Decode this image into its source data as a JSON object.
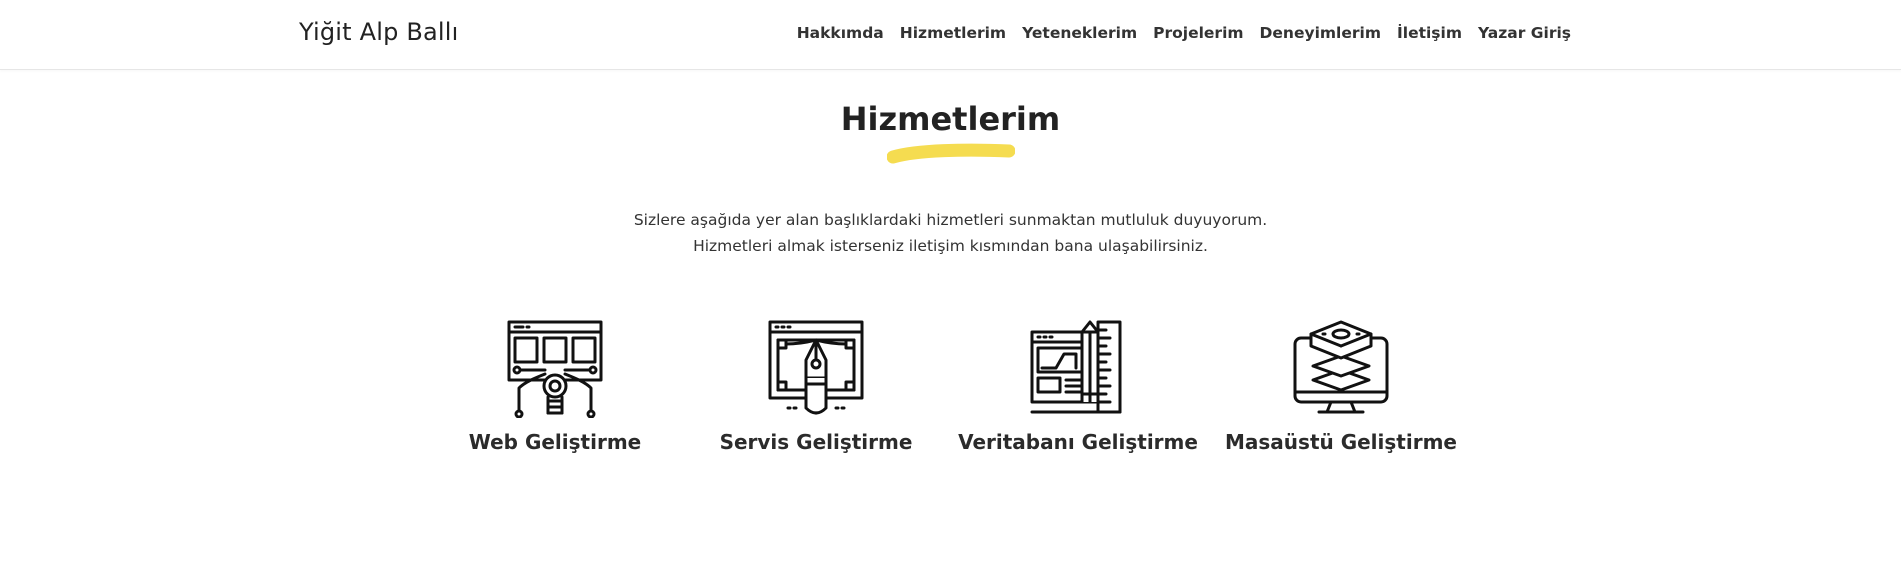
{
  "header": {
    "brand": "Yiğit Alp Ballı",
    "nav": [
      {
        "label": "Hakkımda"
      },
      {
        "label": "Hizmetlerim"
      },
      {
        "label": "Yeteneklerim"
      },
      {
        "label": "Projelerim"
      },
      {
        "label": "Deneyimlerim"
      },
      {
        "label": "İletişim"
      },
      {
        "label": "Yazar Giriş"
      }
    ]
  },
  "services_section": {
    "title": "Hizmetlerim",
    "underline_color": "#f5dc50",
    "intro_line1": "Sizlere aşağıda yer alan başlıklardaki hizmetleri sunmaktan mutluluk duyuyorum.",
    "intro_line2": "Hizmetleri almak isterseniz iletişim kısmından bana ulaşabilirsiniz.",
    "items": [
      {
        "title": "Web Geliştirme",
        "icon": "web-development-icon"
      },
      {
        "title": "Servis Geliştirme",
        "icon": "service-design-icon"
      },
      {
        "title": "Veritabanı Geliştirme",
        "icon": "database-design-icon"
      },
      {
        "title": "Masaüstü Geliştirme",
        "icon": "desktop-layers-icon"
      }
    ]
  }
}
